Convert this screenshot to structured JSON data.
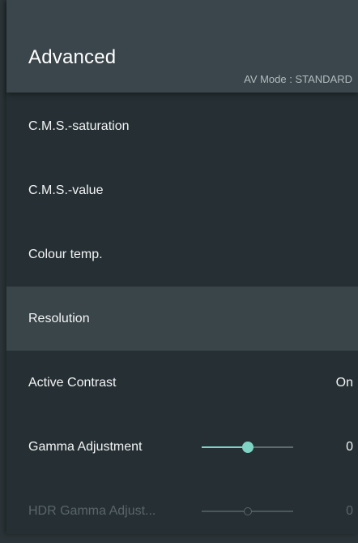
{
  "header": {
    "title": "Advanced",
    "av_mode": "AV Mode : STANDARD"
  },
  "items": [
    {
      "label": "C.M.S.-saturation",
      "value": null,
      "focused": false,
      "disabled": false
    },
    {
      "label": "C.M.S.-value",
      "value": null,
      "focused": false,
      "disabled": false
    },
    {
      "label": "Colour temp.",
      "value": null,
      "focused": false,
      "disabled": false
    },
    {
      "label": "Resolution",
      "value": null,
      "focused": true,
      "disabled": false
    },
    {
      "label": "Active Contrast",
      "value": "On",
      "focused": false,
      "disabled": false
    },
    {
      "label": "Gamma Adjustment",
      "value": "0",
      "focused": false,
      "disabled": false,
      "slider_level_pct": 50,
      "slider_color": "#7fd3c4"
    },
    {
      "label": "HDR Gamma Adjust...",
      "value": "0",
      "focused": false,
      "disabled": true,
      "slider_level_pct": 50
    }
  ],
  "colors": {
    "header_bg": "#3a464b",
    "panel_bg": "#263034",
    "focus_bg": "#3a4549",
    "accent": "#7fd3c4"
  }
}
